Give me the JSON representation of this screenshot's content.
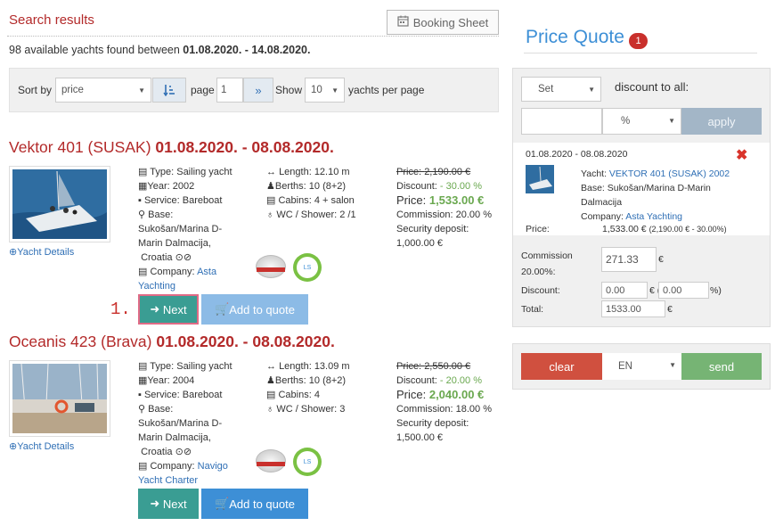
{
  "header": {
    "title": "Search results",
    "booking_sheet": "Booking Sheet",
    "found_prefix": "98 available yachts found between ",
    "found_dates": "01.08.2020. - 14.08.2020."
  },
  "sortbar": {
    "sort_by": "Sort by",
    "sort_value": "price",
    "page_label": "page",
    "page_value": "1",
    "show_label": "Show",
    "show_value": "10",
    "per_page": "yachts per page"
  },
  "yachts": [
    {
      "name": "Vektor 401 (SUSAK) ",
      "dates": "01.08.2020. - 08.08.2020.",
      "details": "Yacht Details",
      "type": "Type: Sailing yacht",
      "year": "Year: 2002",
      "service": "Service: Bareboat",
      "base_label": "Base:",
      "base1": "Sukošan/Marina D-",
      "base2": "Marin Dalmacija,",
      "base3": "Croatia",
      "company_label": "Company: ",
      "company1": "Asta",
      "company2": "Yachting",
      "length": "Length: 12.10 m",
      "berths": "Berths: 10 (8+2)",
      "cabins": "Cabins: 4 + salon",
      "wc": "WC / Shower: 2 /1",
      "old_price": "2,190.00 €",
      "price_label": "Price: ",
      "discount_label": "Discount: ",
      "discount": "- 30.00 %",
      "price": "1,533.00 €",
      "commission": "Commission: 20.00 %",
      "deposit_label": "Security deposit:",
      "deposit": "1,000.00 €",
      "next": "Next",
      "add": "Add to quote"
    },
    {
      "name": "Oceanis 423 (Brava) ",
      "dates": "01.08.2020. - 08.08.2020.",
      "details": "Yacht Details",
      "type": "Type: Sailing yacht",
      "year": "Year: 2004",
      "service": "Service: Bareboat",
      "base_label": "Base:",
      "base1": "Sukošan/Marina D-",
      "base2": "Marin Dalmacija,",
      "base3": "Croatia",
      "company_label": "Company: ",
      "company1": "Navigo",
      "company2": "Yacht Charter",
      "length": "Length: 13.09 m",
      "berths": "Berths: 10 (8+2)",
      "cabins": "Cabins: 4",
      "wc": "WC / Shower: 3",
      "old_price": "2,550.00 €",
      "price_label": "Price: ",
      "discount_label": "Discount: ",
      "discount": "- 20.00 %",
      "price": "2,040.00 €",
      "commission": "Commission: 18.00 %",
      "deposit_label": "Security deposit:",
      "deposit": "1,500.00 €",
      "next": "Next",
      "add": "Add to quote"
    }
  ],
  "step_label": "1.",
  "price_quote": {
    "title": "Price Quote",
    "count": "1",
    "set_value": "Set",
    "discount_all": "discount to all:",
    "unit_value": "%",
    "apply": "apply",
    "item_dates": "01.08.2020 - 08.08.2020",
    "yacht_label": "Yacht: ",
    "yacht_name": "VEKTOR 401 (SUSAK) 2002",
    "base1": "Base: Sukošan/Marina D-Marin",
    "base2": "Dalmacija",
    "company_label": "Company: ",
    "company_name": "Asta Yachting",
    "price_label": "Price:",
    "price_value": "1,533.00 €",
    "price_detail": "(2,190.00 € - 30.00%)",
    "commission_label1": "Commission",
    "commission_label2": "20.00%:",
    "commission_value": "271.33",
    "euro": "€",
    "discount_label": "Discount:",
    "discount_value": "0.00",
    "discount_pct_prefix": "€ (",
    "discount_pct": "0.00",
    "discount_pct_suffix": "%)",
    "total_label": "Total:",
    "total_value": "1533.00",
    "clear": "clear",
    "lang": "EN",
    "send": "send"
  }
}
